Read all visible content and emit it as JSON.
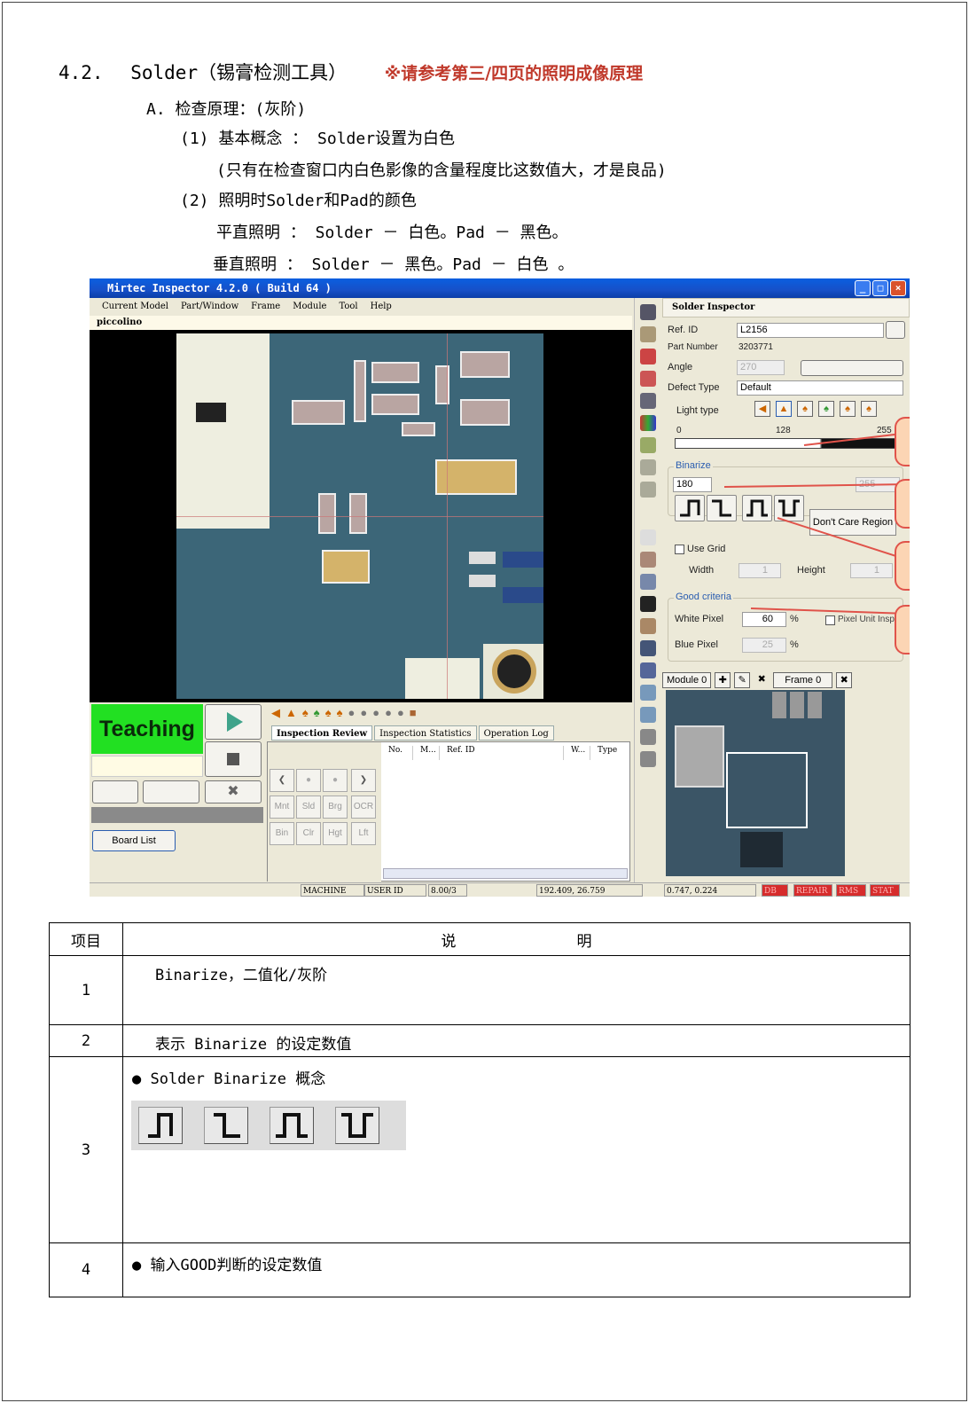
{
  "heading": {
    "section": "4.2.",
    "title": "Solder（锡膏检测工具）",
    "note": "※请参考第三/四页的照明成像原理"
  },
  "lines": {
    "a": "A. 检查原理：(灰阶)",
    "p1": "(1) 基本概念 ： Solder设置为白色",
    "p1_note": "(只有在检查窗口内白色影像的含量程度比这数值大，才是良品)",
    "p2": "(2) 照明时Solder和Pad的颜色",
    "p2_a": "平直照明 ： Solder － 白色。Pad － 黑色。",
    "p2_b": "垂直照明 ： Solder － 黑色。Pad － 白色 。"
  },
  "app": {
    "title": "Mirtec Inspector 4.2.0 ( Build 64 )",
    "menu": [
      "Current Model",
      "Part/Window",
      "Frame",
      "Module",
      "Tool",
      "Help"
    ],
    "model_name": "piccolino",
    "panel_title": "Solder Inspector",
    "ref_id_label": "Ref. ID",
    "ref_id_value": "L2156",
    "part_number_label": "Part Number",
    "part_number_value": "3203771",
    "angle_label": "Angle",
    "angle_value": "270",
    "defect_type_label": "Defect Type",
    "defect_type_value": "Default",
    "light_type_label": "Light type",
    "scale": {
      "min": "0",
      "mid": "128",
      "max": "255"
    },
    "binarize_label": "Binarize",
    "binarize_value": "180",
    "binarize_max": "255",
    "dont_care_label": "Don't Care Region",
    "use_grid_label": "Use Grid",
    "width_label": "Width",
    "width_value": "1",
    "height_label": "Height",
    "height_value": "1",
    "good_criteria_label": "Good criteria",
    "white_pixel_label": "White Pixel",
    "white_pixel_value": "60",
    "blue_pixel_label": "Blue Pixel",
    "blue_pixel_value": "25",
    "percent": "%",
    "pixel_unit_label": "Pixel Unit Insp",
    "module_label": "Module 0",
    "frame_label": "Frame 0",
    "teaching_label": "Teaching",
    "board_list_label": "Board List",
    "tabs": [
      "Inspection Review",
      "Inspection Statistics",
      "Operation Log"
    ],
    "review_columns": [
      "No.",
      "M...",
      "Ref. ID",
      "W...",
      "Type"
    ],
    "grid_buttons": [
      "Mnt",
      "Sld",
      "Brg",
      "OCR",
      "Bin",
      "Clr",
      "Hgt",
      "Lft"
    ],
    "status": {
      "machine_name": "MACHINE NAME",
      "user_id": "USER ID",
      "version": "8.00/3",
      "coord1": "192.409, 26.759",
      "coord2": "0.747, 0.224",
      "flags": [
        "DB",
        "REPAIR",
        "RMS",
        "STAT"
      ]
    }
  },
  "table": {
    "header_item": "项目",
    "header_desc": "说　　　　　　　　明",
    "rows": [
      {
        "idx": "1",
        "text": "Binarize，二值化/灰阶"
      },
      {
        "idx": "2",
        "text": "表示 Binarize 的设定数值"
      },
      {
        "idx": "3",
        "text": "● Solder  Binarize 概念"
      },
      {
        "idx": "4",
        "text": "● 输入GOOD判断的设定数值"
      }
    ]
  }
}
